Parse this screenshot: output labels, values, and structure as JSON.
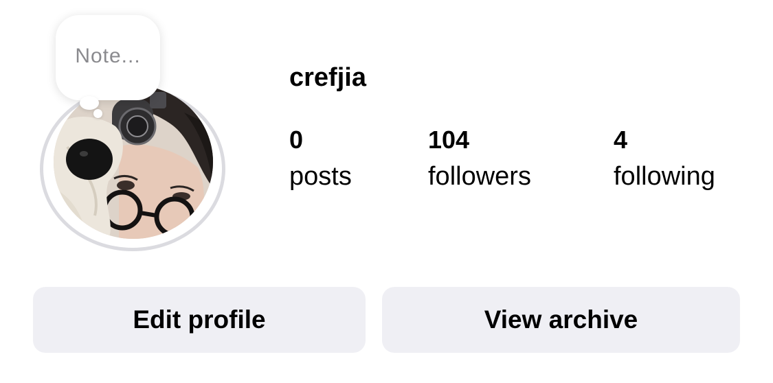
{
  "profile": {
    "username": "crefjia",
    "note_placeholder": "Note...",
    "avatar_icon": "profile-photo"
  },
  "stats": {
    "posts": {
      "count": "0",
      "label": "posts"
    },
    "followers": {
      "count": "104",
      "label": "followers"
    },
    "following": {
      "count": "4",
      "label": "following"
    }
  },
  "actions": {
    "edit_profile": "Edit profile",
    "view_archive": "View archive"
  },
  "colors": {
    "button_bg": "#efeff4",
    "avatar_ring": "#dbdbe0",
    "placeholder_text": "#8a8a8e"
  }
}
